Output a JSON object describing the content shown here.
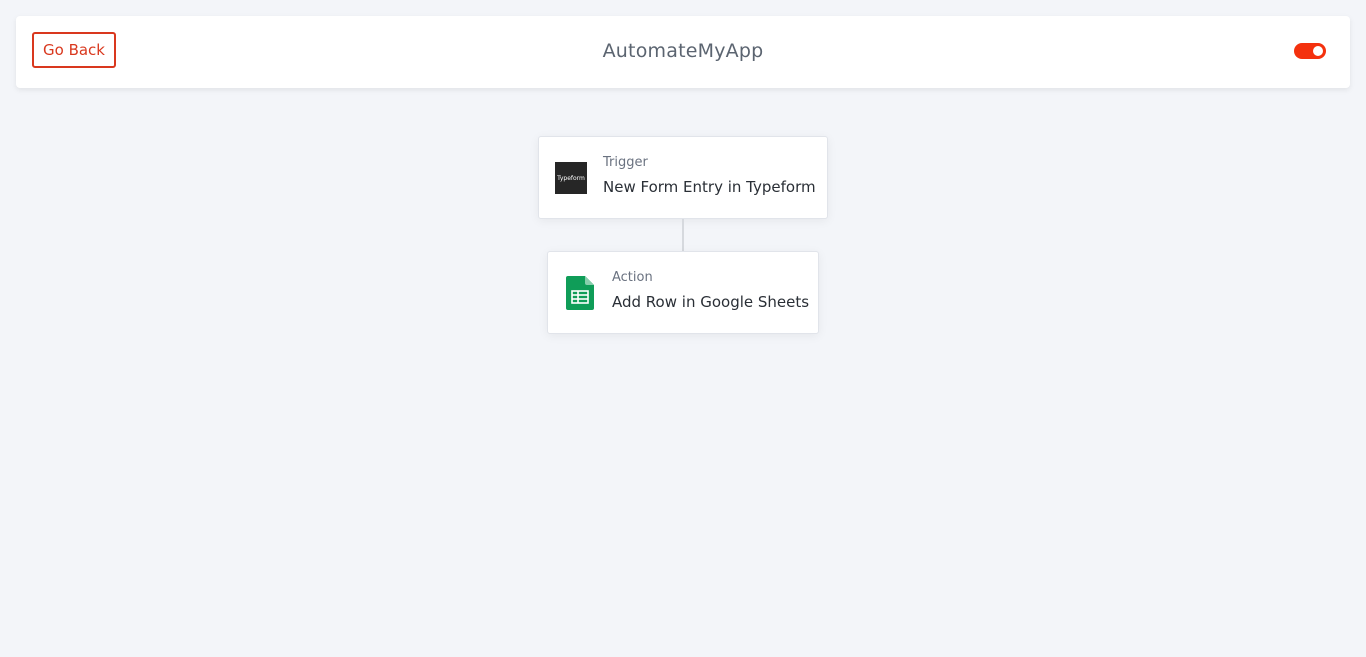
{
  "header": {
    "back_label": "Go Back",
    "title": "AutomateMyApp",
    "toggle_state": "on",
    "accent_color": "#d9381e",
    "toggle_color": "#f4310e"
  },
  "workflow": {
    "trigger": {
      "kind": "Trigger",
      "name": "New Form Entry in Typeform",
      "logo_text": "Typeform",
      "icon": "typeform-icon"
    },
    "action": {
      "kind": "Action",
      "name": "Add Row in Google Sheets",
      "icon": "google-sheets-icon",
      "icon_color": "#0f9d58"
    }
  }
}
